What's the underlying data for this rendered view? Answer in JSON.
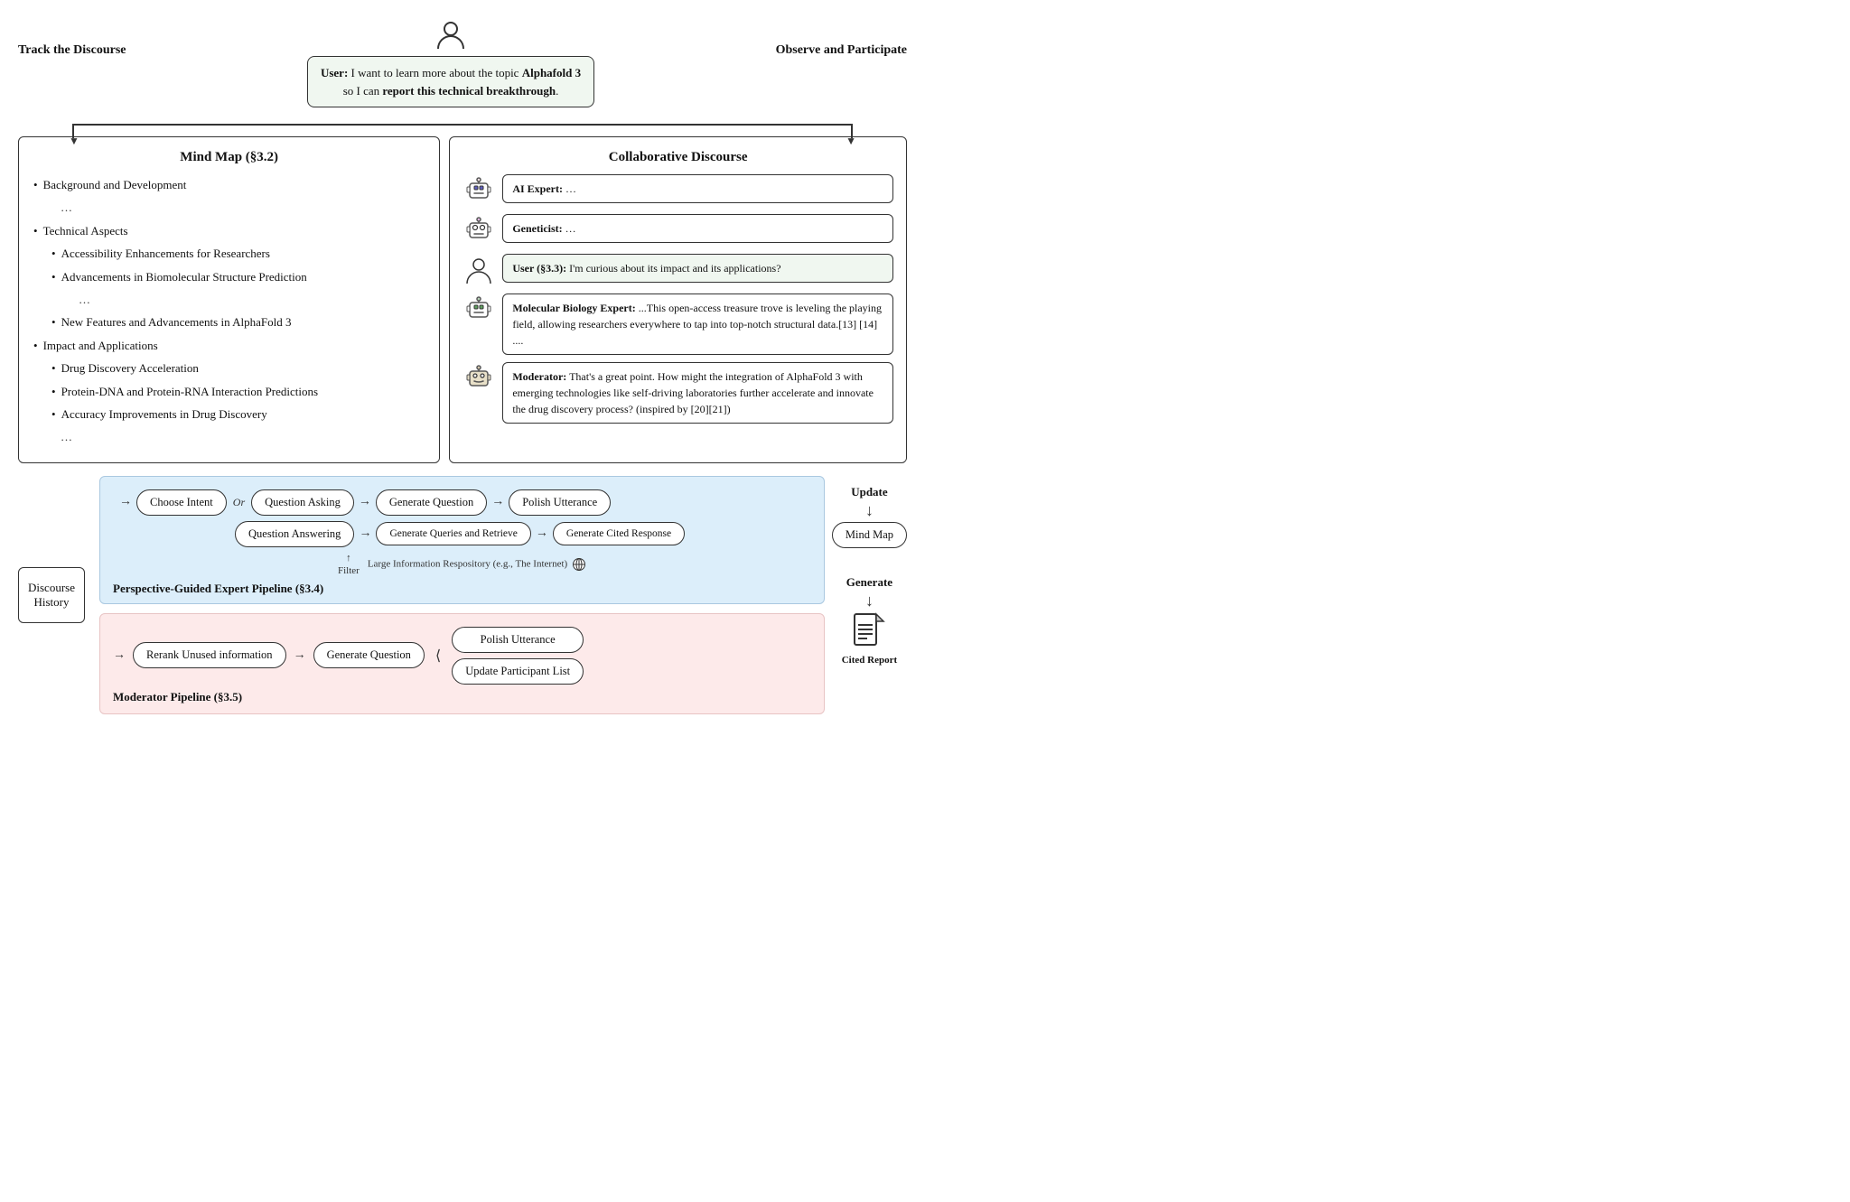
{
  "page": {
    "top": {
      "track_label": "Track the Discourse",
      "observe_label": "Observe and Participate",
      "user_speech": "User: I want to learn more about the topic Alphafold 3 so I can report this technical breakthrough.",
      "user_speech_bold1": "Alphafold 3",
      "user_speech_bold2": "report this technical breakthrough"
    },
    "mind_map": {
      "title": "Mind Map (§3.2)",
      "items": [
        {
          "level": 0,
          "text": "Background and Development"
        },
        {
          "level": -1,
          "text": "…"
        },
        {
          "level": 0,
          "text": "Technical Aspects"
        },
        {
          "level": 1,
          "text": "Accessibility Enhancements for Researchers"
        },
        {
          "level": 1,
          "text": "Advancements in Biomolecular Structure Prediction"
        },
        {
          "level": -1,
          "text": "…"
        },
        {
          "level": 1,
          "text": "New Features and Advancements in AlphaFold 3"
        },
        {
          "level": 0,
          "text": "Impact and Applications"
        },
        {
          "level": 1,
          "text": "Drug Discovery Acceleration"
        },
        {
          "level": 1,
          "text": "Protein-DNA and Protein-RNA Interaction Predictions"
        },
        {
          "level": 1,
          "text": "Accuracy Improvements in Drug Discovery"
        },
        {
          "level": -1,
          "text": "…"
        }
      ]
    },
    "discourse": {
      "title": "Collaborative Discourse",
      "entries": [
        {
          "speaker": "AI Expert",
          "type": "robot1",
          "text": "AI Expert: …"
        },
        {
          "speaker": "Geneticist",
          "type": "robot2",
          "text": "Geneticist: …"
        },
        {
          "speaker": "User (§3.3)",
          "type": "user",
          "text": "User (§3.3): I'm curious about its impact and its applications?",
          "green": true
        },
        {
          "speaker": "Molecular Biology Expert",
          "type": "robot3",
          "text": "Molecular Biology Expert: ...This open-access treasure trove is leveling the playing field, allowing researchers everywhere to tap into top-notch structural data.[13] [14] ...."
        },
        {
          "speaker": "Moderator",
          "type": "robot4",
          "text": "Moderator: That's a great point. How might the integration of AlphaFold 3 with emerging technologies like self-driving laboratories further accelerate and innovate the drug discovery process? (inspired by [20][21])"
        }
      ]
    },
    "pipeline": {
      "title": "Perspective-Guided Expert Pipeline (§3.4)",
      "discourse_history_label": "Discourse\nHistory",
      "choose_intent": "Choose Intent",
      "or_label": "Or",
      "question_asking": "Question Asking",
      "question_answering": "Question Answering",
      "generate_question": "Generate Question",
      "generate_queries": "Generate Queries and Retrieve",
      "polish_utterance_top": "Polish Utterance",
      "generate_cited": "Generate Cited Response",
      "filter_label": "Filter",
      "repository_label": "Large Information Respository (e.g., The Internet)",
      "update_label": "Update",
      "mind_map_label": "Mind Map"
    },
    "moderator": {
      "title": "Moderator Pipeline (§3.5)",
      "rerank": "Rerank Unused information",
      "generate_question": "Generate Question",
      "polish_utterance": "Polish Utterance",
      "update_participant": "Update Participant List",
      "generate_label": "Generate",
      "cited_report_label": "Cited\nReport"
    }
  }
}
